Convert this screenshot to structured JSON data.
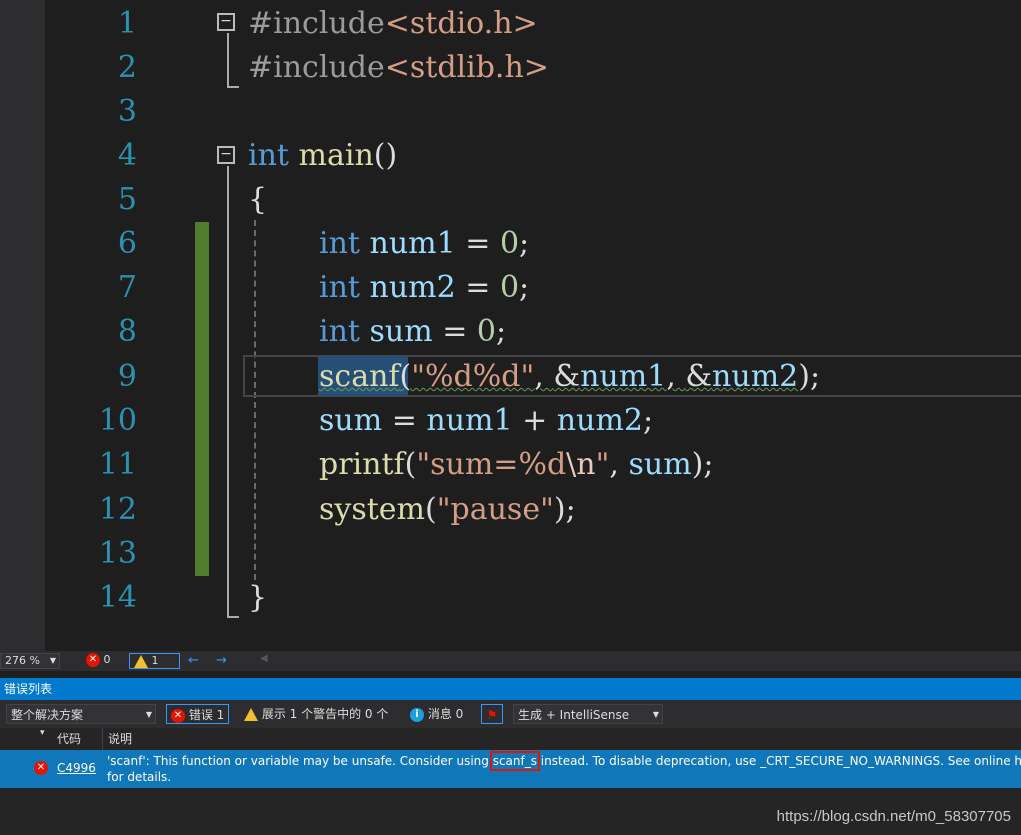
{
  "editor": {
    "line_numbers": [
      "1",
      "2",
      "3",
      "4",
      "5",
      "6",
      "7",
      "8",
      "9",
      "10",
      "11",
      "12",
      "13",
      "14"
    ],
    "line1": {
      "pp": "#include",
      "rest": "<stdio.h>"
    },
    "line2": {
      "pp": "#include",
      "rest": "<stdlib.h>"
    },
    "line4": {
      "kw": "int",
      "fn": "main",
      "rest": "()"
    },
    "line5": "{",
    "line6": {
      "kw": "int",
      "var": "num1",
      "op": " = ",
      "num": "0",
      "end": ";"
    },
    "line7": {
      "kw": "int",
      "var": "num2",
      "op": " = ",
      "num": "0",
      "end": ";"
    },
    "line8": {
      "kw": "int",
      "var": "sum",
      "op": " = ",
      "num": "0",
      "end": ";"
    },
    "line9": {
      "fn": "scanf",
      "p1": "(",
      "str": "\"%d%d\"",
      "sep1": ", ",
      "amp1": "&",
      "v1": "num1",
      "sep2": ", ",
      "amp2": "&",
      "v2": "num2",
      "end": ");"
    },
    "line10": {
      "v1": "sum",
      "op1": " = ",
      "v2": "num1",
      "op2": " + ",
      "v3": "num2",
      "end": ";"
    },
    "line11": {
      "fn": "printf",
      "p1": "(",
      "s1": "\"sum=%d",
      "esc": "\\n",
      "s2": "\"",
      "sep": ", ",
      "v": "sum",
      "end": ");"
    },
    "line12": {
      "fn": "system",
      "p1": "(",
      "str": "\"pause\"",
      "end": ");"
    },
    "line14": "}"
  },
  "statusbar": {
    "zoom": "276 %",
    "errors": "0",
    "warnings": "1"
  },
  "error_list": {
    "title": "错误列表",
    "scope": "整个解决方案",
    "errors_button": "错误 1",
    "warnings_button": "展示 1 个警告中的 0 个",
    "messages_button": "消息 0",
    "build_filter": "生成 + IntelliSense",
    "col_code": "代码",
    "col_desc": "说明",
    "row": {
      "code": "C4996",
      "desc_before": "'scanf': This function or variable may be unsafe. Consider using ",
      "desc_highlight": "scanf_s",
      "desc_after": " instead. To disable deprecation, use _CRT_SECURE_NO_WARNINGS. See online help",
      "desc_line2": "for details."
    }
  },
  "watermark": "https://blog.csdn.net/m0_58307705",
  "colors": {
    "accent": "#007acc",
    "selected_row": "#1177bb",
    "error": "#e51400",
    "warning": "#f2c02c",
    "highlight_box": "#e51400"
  }
}
